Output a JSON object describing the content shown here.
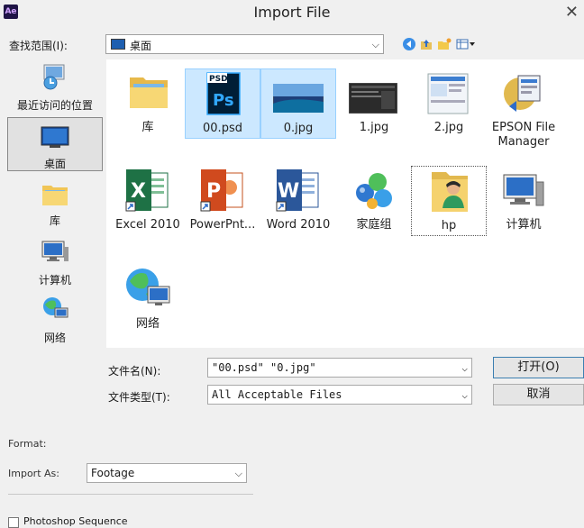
{
  "window": {
    "title": "Import File",
    "app_badge": "Ae",
    "close_glyph": "✕"
  },
  "lookin": {
    "label": "查找范围(I):",
    "value": "桌面"
  },
  "places": [
    {
      "label": "最近访问的位置",
      "icon": "recent-places-icon"
    },
    {
      "label": "桌面",
      "icon": "desktop-icon",
      "selected": true
    },
    {
      "label": "库",
      "icon": "library-folder-icon"
    },
    {
      "label": "计算机",
      "icon": "computer-icon"
    },
    {
      "label": "网络",
      "icon": "network-icon"
    }
  ],
  "files": [
    {
      "label": "库",
      "icon": "library-folder-icon"
    },
    {
      "label": "00.psd",
      "icon": "psd-file-icon",
      "badge": "PSD",
      "app": "Ps",
      "selected": true
    },
    {
      "label": "0.jpg",
      "icon": "jpg-thumbnail-icon",
      "selected": true
    },
    {
      "label": "1.jpg",
      "icon": "jpg-thumbnail-icon"
    },
    {
      "label": "2.jpg",
      "icon": "jpg-thumbnail-icon"
    },
    {
      "label": "EPSON File\nManager",
      "icon": "epson-app-icon"
    },
    {
      "label": "Excel 2010",
      "icon": "excel-icon",
      "app": "X"
    },
    {
      "label": "PowerPnt...",
      "icon": "powerpoint-icon",
      "app": "P"
    },
    {
      "label": "Word 2010",
      "icon": "word-icon",
      "app": "W"
    },
    {
      "label": "家庭组",
      "icon": "homegroup-icon"
    },
    {
      "label": "hp",
      "icon": "user-folder-icon",
      "focused": true
    },
    {
      "label": "计算机",
      "icon": "computer-icon"
    },
    {
      "label": "网络",
      "icon": "network-icon"
    }
  ],
  "filename": {
    "label": "文件名(N):",
    "value": "\"00.psd\" \"0.jpg\""
  },
  "filetype": {
    "label": "文件类型(T):",
    "value": "All Acceptable Files"
  },
  "buttons": {
    "open": "打开(O)",
    "cancel": "取消"
  },
  "lower": {
    "format_label": "Format:",
    "import_as_label": "Import As:",
    "import_as_value": "Footage",
    "checkbox_label": "Photoshop Sequence"
  },
  "colors": {
    "selection_fill": "#cce8ff",
    "selection_border": "#99d1ff",
    "pane_bg": "#ffffff",
    "dialog_bg": "#f0f0f0"
  }
}
